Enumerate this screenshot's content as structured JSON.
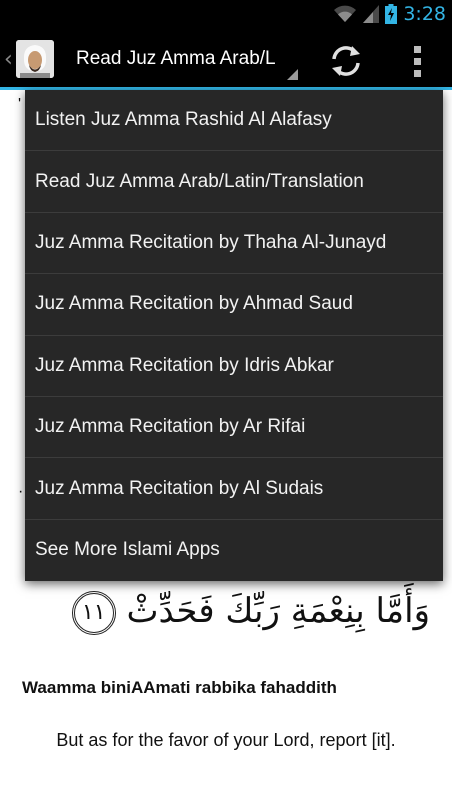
{
  "status_bar": {
    "time": "3:28",
    "icons": [
      "wifi-icon",
      "signal-icon",
      "battery-icon"
    ]
  },
  "action_bar": {
    "up_caret": "‹",
    "nav_title": "Read Juz Amma Arab/L",
    "icons": [
      "app-avatar",
      "refresh-icon",
      "overflow-menu-icon"
    ]
  },
  "dropdown": {
    "items": [
      "Listen Juz Amma Rashid Al Alafasy",
      "Read Juz Amma Arab/Latin/Translation",
      "Juz Amma Recitation by Thaha Al-Junayd",
      "Juz Amma Recitation by Ahmad Saud",
      "Juz Amma Recitation by Idris Abkar",
      "Juz Amma Recitation by Ar Rifai",
      "Juz Amma Recitation by Al Sudais",
      "See More Islami Apps"
    ]
  },
  "content": {
    "arabic_verse": "وَأَمَّا بِنِعْمَةِ رَبِّكَ فَحَدِّثْ",
    "verse_number": "١١",
    "transliteration": "Waamma biniAAmati rabbika fahaddith",
    "translation": "But as for the favor of your Lord, report [it]."
  },
  "colors": {
    "accent": "#33b5e5",
    "menu_bg": "#272727",
    "action_bar_bg": "#000000"
  }
}
